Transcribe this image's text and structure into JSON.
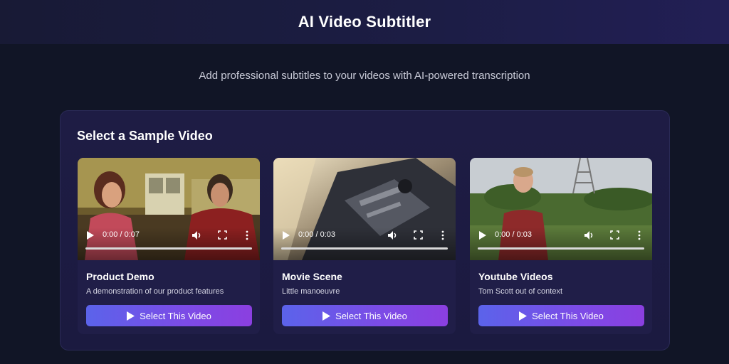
{
  "header": {
    "title": "AI Video Subtitler"
  },
  "tagline": "Add professional subtitles to your videos with AI-powered transcription",
  "panel": {
    "title": "Select a Sample Video",
    "videos": [
      {
        "title": "Product Demo",
        "description": "A demonstration of our product features",
        "time": "0:00 / 0:07",
        "button_label": "Select This Video"
      },
      {
        "title": "Movie Scene",
        "description": "Little manoeuvre",
        "time": "0:00 / 0:03",
        "button_label": "Select This Video"
      },
      {
        "title": "Youtube Videos",
        "description": "Tom Scott out of context",
        "time": "0:00 / 0:03",
        "button_label": "Select This Video"
      }
    ]
  },
  "icons": {
    "play": "play-icon",
    "volume": "volume-icon",
    "fullscreen": "fullscreen-icon",
    "more": "more-vertical-icon"
  },
  "colors": {
    "background": "#111526",
    "button_start": "#5b63ea",
    "button_end": "#8b3fe0"
  }
}
